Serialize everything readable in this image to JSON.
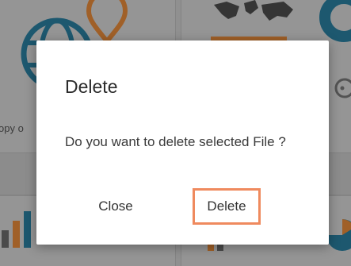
{
  "background": {
    "snippet_text": "opy o",
    "icons": [
      "globe-icon",
      "map-pin-icon",
      "world-map-icon",
      "donut-chart-icon",
      "gauge-icon",
      "bar-chart-icon",
      "pie-chart-icon"
    ]
  },
  "dialog": {
    "title": "Delete",
    "message": "Do you want to delete selected File ?",
    "close_label": "Close",
    "delete_label": "Delete"
  },
  "colors": {
    "accent_orange": "#ef8a5e",
    "icon_teal": "#2a7fa0",
    "backdrop_dim": "rgba(0,0,0,0.30)"
  }
}
